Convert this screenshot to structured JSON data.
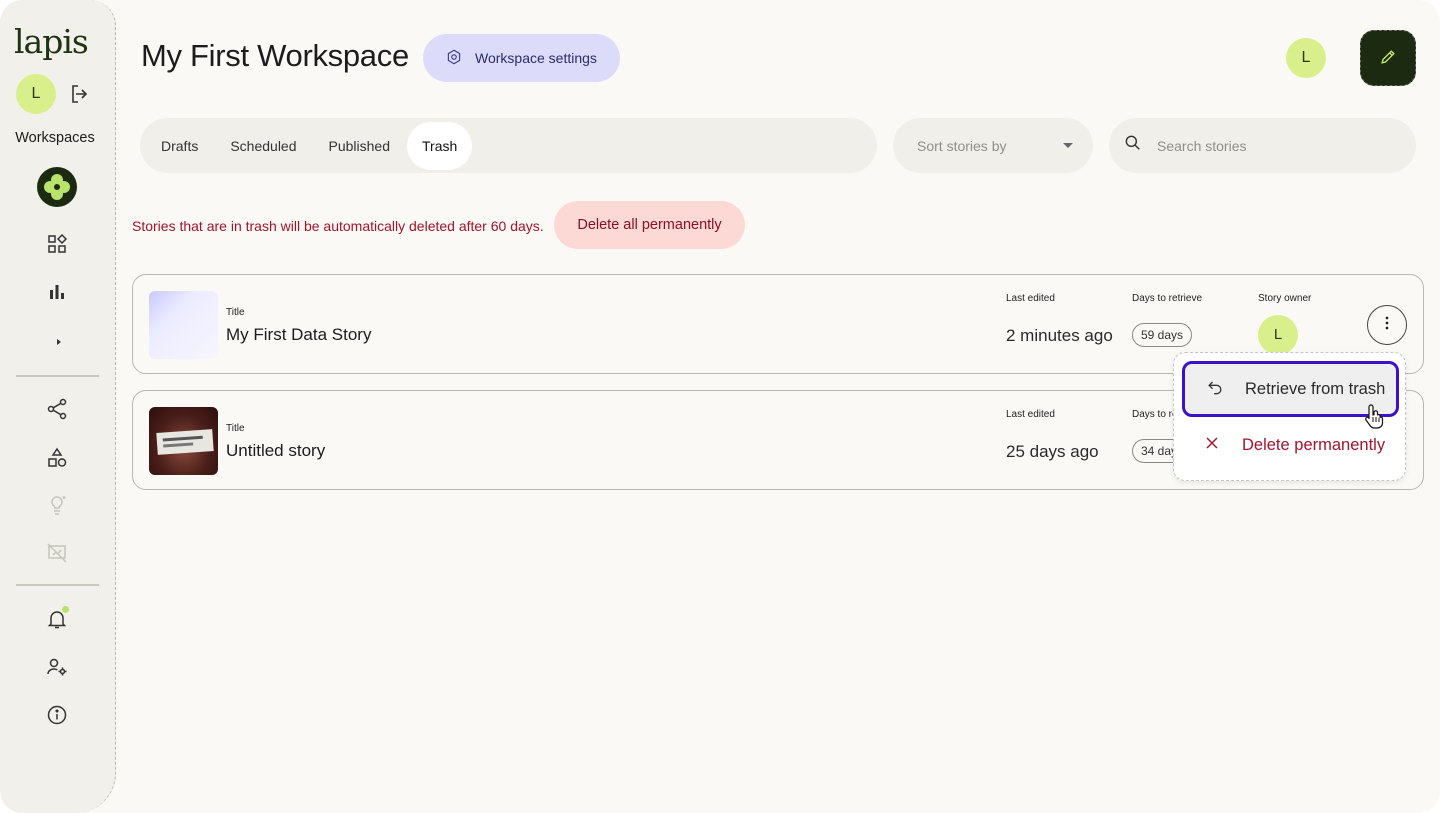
{
  "app": {
    "logo_text": "lapis"
  },
  "sidebar": {
    "avatar_initial": "L",
    "workspaces_label": "Workspaces"
  },
  "header": {
    "title": "My First Workspace",
    "settings_label": "Workspace settings",
    "avatar_initial": "L"
  },
  "tabs": [
    "Drafts",
    "Scheduled",
    "Published",
    "Trash"
  ],
  "active_tab": "Trash",
  "sort": {
    "placeholder": "Sort stories by"
  },
  "search": {
    "placeholder": "Search stories"
  },
  "trash": {
    "notice": "Stories that are in trash will be automatically deleted after 60 days.",
    "delete_all_label": "Delete all permanently"
  },
  "stories": [
    {
      "title_label": "Title",
      "title": "My First Data Story",
      "last_edited_label": "Last edited",
      "last_edited": "2 minutes ago",
      "days_label": "Days to retrieve",
      "days": "59 days",
      "owner_label": "Story owner",
      "owner_initial": "L"
    },
    {
      "title_label": "Title",
      "title": "Untitled story",
      "last_edited_label": "Last edited",
      "last_edited": "25 days ago",
      "days_label": "Days to re",
      "days": "34 day"
    }
  ],
  "menu": {
    "retrieve_label": "Retrieve from trash",
    "delete_label": "Delete permanently"
  },
  "colors": {
    "brand_dark": "#1c2a12",
    "avatar_green": "#d9ef8b",
    "settings_bg": "#dcdcfa",
    "danger": "#a3142a",
    "danger_bg": "#fdd9d6",
    "focus_ring": "#3b12c7"
  }
}
